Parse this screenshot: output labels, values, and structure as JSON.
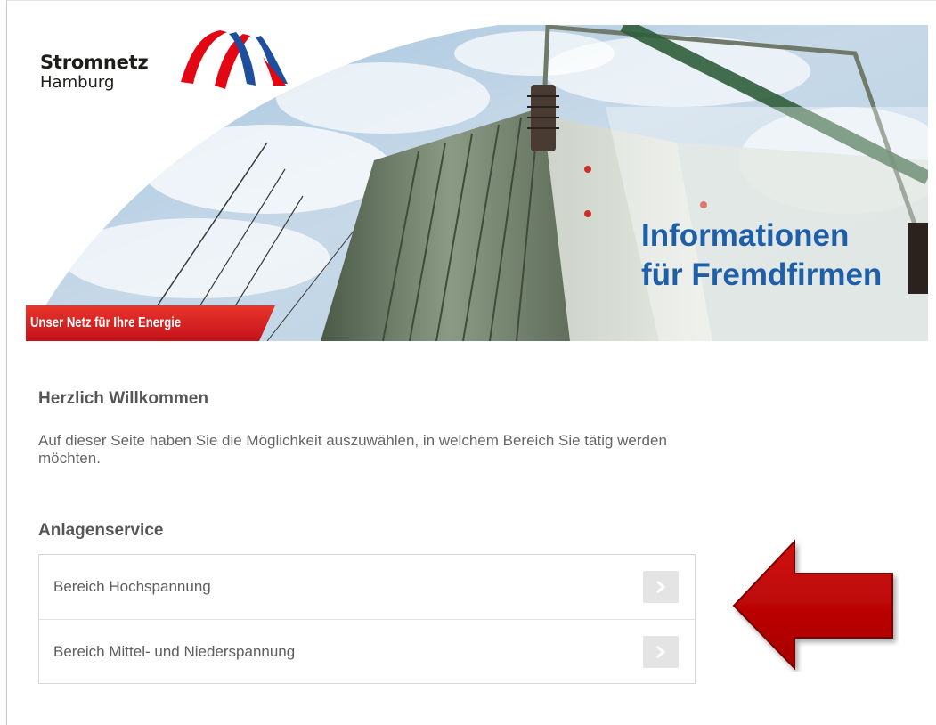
{
  "brand": {
    "name_line1": "Stromnetz",
    "name_line2": "Hamburg",
    "colors": {
      "red": "#e30613",
      "blue": "#1d4f9c"
    }
  },
  "hero": {
    "title_line1": "Informationen",
    "title_line2": "für Fremdfirmen",
    "slogan": "Unser Netz für Ihre Energie",
    "image": "transformer-with-power-lines-against-cloudy-sky"
  },
  "welcome": {
    "title": "Herzlich Willkommen",
    "text": "Auf dieser Seite haben Sie die Möglichkeit auszuwählen, in welchem Bereich Sie tätig werden möchten."
  },
  "anlagenservice": {
    "title": "Anlagenservice",
    "items": [
      {
        "label": "Bereich Hochspannung",
        "icon": "chevron-right-icon"
      },
      {
        "label": "Bereich Mittel- und Niederspannung",
        "icon": "chevron-right-icon"
      }
    ]
  },
  "annotation": {
    "icon": "red-arrow-left-icon",
    "color": "#c00000"
  }
}
